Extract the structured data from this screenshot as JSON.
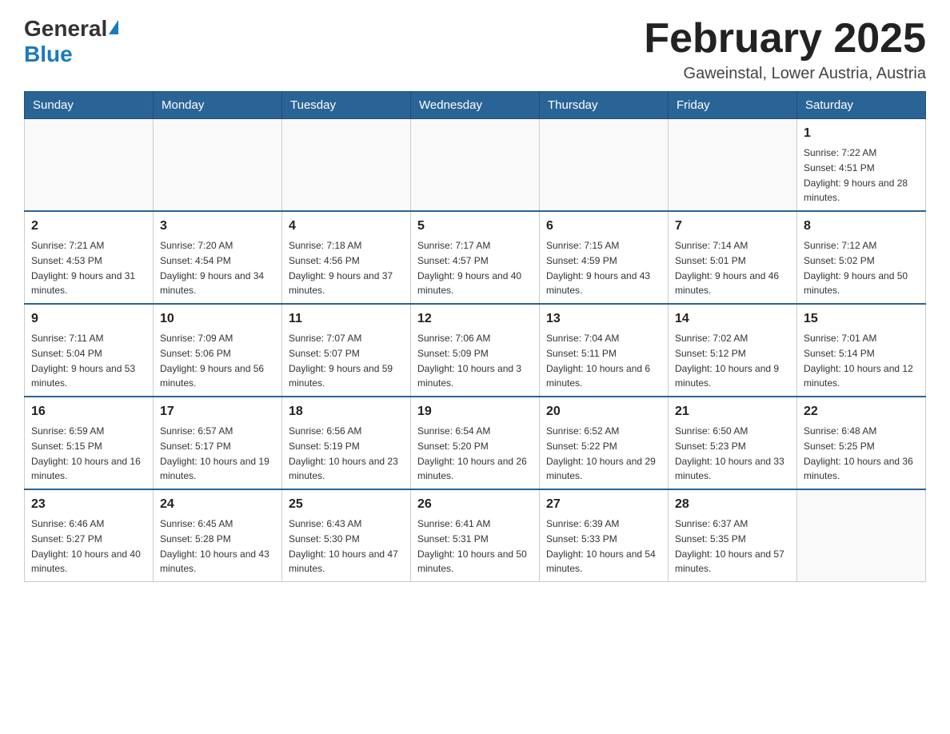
{
  "header": {
    "logo_general": "General",
    "logo_blue": "Blue",
    "month_title": "February 2025",
    "location": "Gaweinstal, Lower Austria, Austria"
  },
  "days_of_week": [
    "Sunday",
    "Monday",
    "Tuesday",
    "Wednesday",
    "Thursday",
    "Friday",
    "Saturday"
  ],
  "weeks": [
    [
      {
        "day": "",
        "info": ""
      },
      {
        "day": "",
        "info": ""
      },
      {
        "day": "",
        "info": ""
      },
      {
        "day": "",
        "info": ""
      },
      {
        "day": "",
        "info": ""
      },
      {
        "day": "",
        "info": ""
      },
      {
        "day": "1",
        "info": "Sunrise: 7:22 AM\nSunset: 4:51 PM\nDaylight: 9 hours and 28 minutes."
      }
    ],
    [
      {
        "day": "2",
        "info": "Sunrise: 7:21 AM\nSunset: 4:53 PM\nDaylight: 9 hours and 31 minutes."
      },
      {
        "day": "3",
        "info": "Sunrise: 7:20 AM\nSunset: 4:54 PM\nDaylight: 9 hours and 34 minutes."
      },
      {
        "day": "4",
        "info": "Sunrise: 7:18 AM\nSunset: 4:56 PM\nDaylight: 9 hours and 37 minutes."
      },
      {
        "day": "5",
        "info": "Sunrise: 7:17 AM\nSunset: 4:57 PM\nDaylight: 9 hours and 40 minutes."
      },
      {
        "day": "6",
        "info": "Sunrise: 7:15 AM\nSunset: 4:59 PM\nDaylight: 9 hours and 43 minutes."
      },
      {
        "day": "7",
        "info": "Sunrise: 7:14 AM\nSunset: 5:01 PM\nDaylight: 9 hours and 46 minutes."
      },
      {
        "day": "8",
        "info": "Sunrise: 7:12 AM\nSunset: 5:02 PM\nDaylight: 9 hours and 50 minutes."
      }
    ],
    [
      {
        "day": "9",
        "info": "Sunrise: 7:11 AM\nSunset: 5:04 PM\nDaylight: 9 hours and 53 minutes."
      },
      {
        "day": "10",
        "info": "Sunrise: 7:09 AM\nSunset: 5:06 PM\nDaylight: 9 hours and 56 minutes."
      },
      {
        "day": "11",
        "info": "Sunrise: 7:07 AM\nSunset: 5:07 PM\nDaylight: 9 hours and 59 minutes."
      },
      {
        "day": "12",
        "info": "Sunrise: 7:06 AM\nSunset: 5:09 PM\nDaylight: 10 hours and 3 minutes."
      },
      {
        "day": "13",
        "info": "Sunrise: 7:04 AM\nSunset: 5:11 PM\nDaylight: 10 hours and 6 minutes."
      },
      {
        "day": "14",
        "info": "Sunrise: 7:02 AM\nSunset: 5:12 PM\nDaylight: 10 hours and 9 minutes."
      },
      {
        "day": "15",
        "info": "Sunrise: 7:01 AM\nSunset: 5:14 PM\nDaylight: 10 hours and 12 minutes."
      }
    ],
    [
      {
        "day": "16",
        "info": "Sunrise: 6:59 AM\nSunset: 5:15 PM\nDaylight: 10 hours and 16 minutes."
      },
      {
        "day": "17",
        "info": "Sunrise: 6:57 AM\nSunset: 5:17 PM\nDaylight: 10 hours and 19 minutes."
      },
      {
        "day": "18",
        "info": "Sunrise: 6:56 AM\nSunset: 5:19 PM\nDaylight: 10 hours and 23 minutes."
      },
      {
        "day": "19",
        "info": "Sunrise: 6:54 AM\nSunset: 5:20 PM\nDaylight: 10 hours and 26 minutes."
      },
      {
        "day": "20",
        "info": "Sunrise: 6:52 AM\nSunset: 5:22 PM\nDaylight: 10 hours and 29 minutes."
      },
      {
        "day": "21",
        "info": "Sunrise: 6:50 AM\nSunset: 5:23 PM\nDaylight: 10 hours and 33 minutes."
      },
      {
        "day": "22",
        "info": "Sunrise: 6:48 AM\nSunset: 5:25 PM\nDaylight: 10 hours and 36 minutes."
      }
    ],
    [
      {
        "day": "23",
        "info": "Sunrise: 6:46 AM\nSunset: 5:27 PM\nDaylight: 10 hours and 40 minutes."
      },
      {
        "day": "24",
        "info": "Sunrise: 6:45 AM\nSunset: 5:28 PM\nDaylight: 10 hours and 43 minutes."
      },
      {
        "day": "25",
        "info": "Sunrise: 6:43 AM\nSunset: 5:30 PM\nDaylight: 10 hours and 47 minutes."
      },
      {
        "day": "26",
        "info": "Sunrise: 6:41 AM\nSunset: 5:31 PM\nDaylight: 10 hours and 50 minutes."
      },
      {
        "day": "27",
        "info": "Sunrise: 6:39 AM\nSunset: 5:33 PM\nDaylight: 10 hours and 54 minutes."
      },
      {
        "day": "28",
        "info": "Sunrise: 6:37 AM\nSunset: 5:35 PM\nDaylight: 10 hours and 57 minutes."
      },
      {
        "day": "",
        "info": ""
      }
    ]
  ]
}
